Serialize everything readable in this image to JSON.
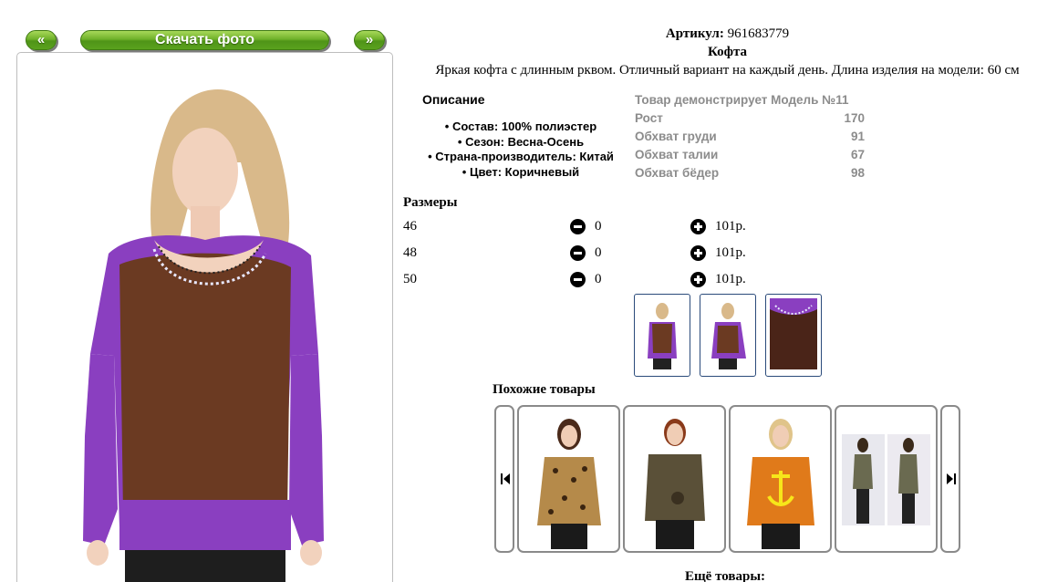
{
  "nav": {
    "prev_label": "«",
    "download_label": "Скачать фото",
    "next_label": "»"
  },
  "product": {
    "article_label": "Артикул:",
    "article_value": "961683779",
    "title": "Кофта",
    "description": "Яркая кофта с длинным рквом. Отличный вариант на каждый день. Длина изделия на модели: 60 см"
  },
  "specs": {
    "heading": "Описание",
    "items": [
      "Состав: 100% полиэстер",
      "Сезон: Весна-Осень",
      "Страна-производитель: Китай",
      "Цвет: Коричневый"
    ]
  },
  "model": {
    "heading": "Товар демонстрирует Модель №11",
    "rows": [
      {
        "label": "Рост",
        "value": "170"
      },
      {
        "label": "Обхват груди",
        "value": "91"
      },
      {
        "label": "Обхват талии",
        "value": "67"
      },
      {
        "label": "Обхват бёдер",
        "value": "98"
      }
    ]
  },
  "sizes": {
    "heading": "Размеры",
    "rows": [
      {
        "size": "46",
        "qty": "0",
        "price": "101р."
      },
      {
        "size": "48",
        "qty": "0",
        "price": "101р."
      },
      {
        "size": "50",
        "qty": "0",
        "price": "101р."
      }
    ]
  },
  "similar": {
    "heading": "Похожие товары"
  },
  "more": {
    "heading": "Ещё товары:"
  },
  "colors": {
    "accent_green": "#5aa21e",
    "purple": "#8a3fc0",
    "brown": "#6b3a22",
    "model_text": "#8c8c8c"
  },
  "icons": {
    "minus": "minus-circle-icon",
    "plus": "plus-circle-icon",
    "carousel_prev": "skip-back-icon",
    "carousel_next": "skip-forward-icon"
  }
}
